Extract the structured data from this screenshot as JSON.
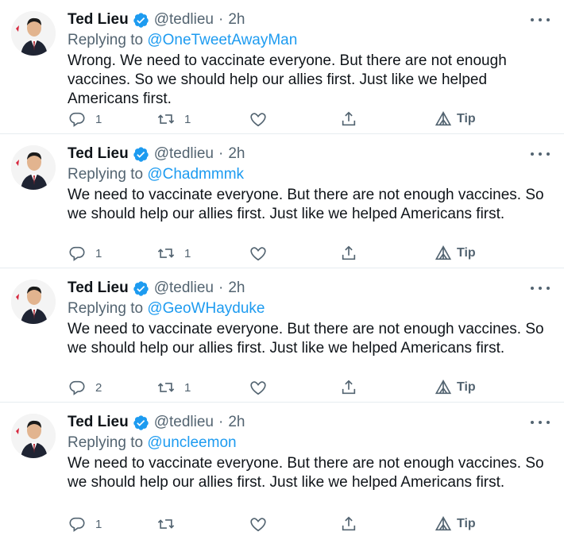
{
  "colors": {
    "link": "#1d9bf0",
    "muted": "#536471",
    "text": "#0f1419",
    "verified": "#1d9bf0"
  },
  "icons": [
    "verified-badge-icon",
    "more-icon",
    "reply-icon",
    "retweet-icon",
    "like-icon",
    "share-icon",
    "tip-icon"
  ],
  "tweets": [
    {
      "name": "Ted Lieu",
      "handle": "@tedlieu",
      "time": "2h",
      "replying_prefix": "Replying to ",
      "replying_to": "@OneTweetAwayMan",
      "text": "Wrong. We need to vaccinate everyone. But there are not enough vaccines. So we should help our allies first. Just like we helped Americans first.",
      "reply_count": "1",
      "retweet_count": "1",
      "like_count": "",
      "tip_label": "Tip"
    },
    {
      "name": "Ted Lieu",
      "handle": "@tedlieu",
      "time": "2h",
      "replying_prefix": "Replying to ",
      "replying_to": "@Chadmmmk",
      "text": "We need to vaccinate everyone. But there are not enough vaccines. So we should help our allies first. Just like we helped Americans first.",
      "reply_count": "1",
      "retweet_count": "1",
      "like_count": "",
      "tip_label": "Tip"
    },
    {
      "name": "Ted Lieu",
      "handle": "@tedlieu",
      "time": "2h",
      "replying_prefix": "Replying to ",
      "replying_to": "@GeoWHayduke",
      "text": "We need to vaccinate everyone. But there are not enough vaccines. So we should help our allies first. Just like we helped Americans first.",
      "reply_count": "2",
      "retweet_count": "1",
      "like_count": "",
      "tip_label": "Tip"
    },
    {
      "name": "Ted Lieu",
      "handle": "@tedlieu",
      "time": "2h",
      "replying_prefix": "Replying to ",
      "replying_to": "@uncleemon",
      "text": "We need to vaccinate everyone. But there are not enough vaccines. So we should help our allies first. Just like we helped Americans first.",
      "reply_count": "1",
      "retweet_count": "",
      "like_count": "",
      "tip_label": "Tip"
    }
  ]
}
